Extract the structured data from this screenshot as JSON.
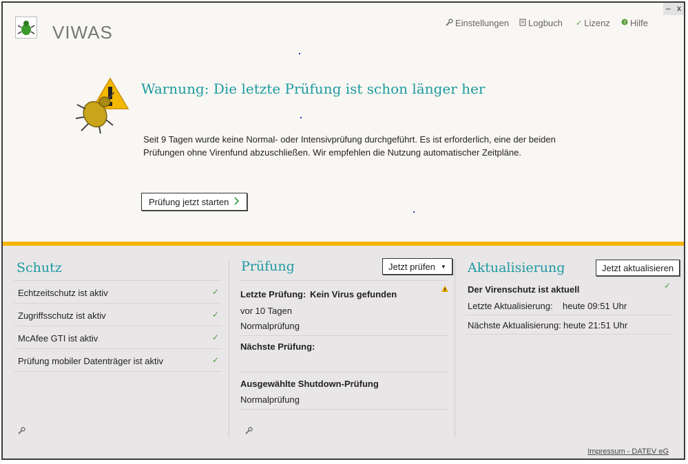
{
  "app": {
    "title": "VIWAS"
  },
  "window_controls": {
    "minimize": "–",
    "close": "x"
  },
  "nav": [
    {
      "label": "Einstellungen",
      "icon": "wrench-icon",
      "glyph": "🔧"
    },
    {
      "label": "Logbuch",
      "icon": "notebook-icon",
      "glyph": "📓"
    },
    {
      "label": "Lizenz",
      "icon": "check-icon",
      "glyph": "✓"
    },
    {
      "label": "Hilfe",
      "icon": "help-icon",
      "glyph": "●"
    }
  ],
  "warning": {
    "title": "Warnung: Die letzte Prüfung ist schon länger her",
    "text": "Seit 9 Tagen wurde keine Normal- oder Intensivprüfung durchgeführt. Es ist erforderlich, eine der beiden Prüfungen ohne Virenfund abzuschließen. Wir empfehlen die Nutzung automatischer Zeitpläne.",
    "button": "Prüfung jetzt starten"
  },
  "schutz": {
    "title": "Schutz",
    "items": [
      "Echtzeitschutz ist aktiv",
      "Zugriffsschutz ist aktiv",
      "McAfee GTI ist aktiv",
      "Prüfung mobiler Datenträger ist aktiv"
    ]
  },
  "pruefung": {
    "title": "Prüfung",
    "button": "Jetzt prüfen",
    "last_label": "Letzte Prüfung:",
    "last_result": "Kein Virus gefunden",
    "last_when": "vor 10 Tagen",
    "last_type": "Normalprüfung",
    "next_label": "Nächste Prüfung:",
    "shutdown_label": "Ausgewählte Shutdown-Prüfung",
    "shutdown_type": "Normalprüfung"
  },
  "aktualisierung": {
    "title": "Aktualisierung",
    "button": "Jetzt aktualisieren",
    "status": "Der Virenschutz ist aktuell",
    "last_label": "Letzte Aktualisierung:",
    "last_value": "heute 09:51 Uhr",
    "next_label": "Nächste Aktualisierung:",
    "next_value": "heute 21:51 Uhr"
  },
  "footer": {
    "text": "Impressum - DATEV eG"
  },
  "colors": {
    "accent": "#1c9aa0",
    "warning_bar": "#f2b600",
    "check": "#4a9b3a"
  }
}
